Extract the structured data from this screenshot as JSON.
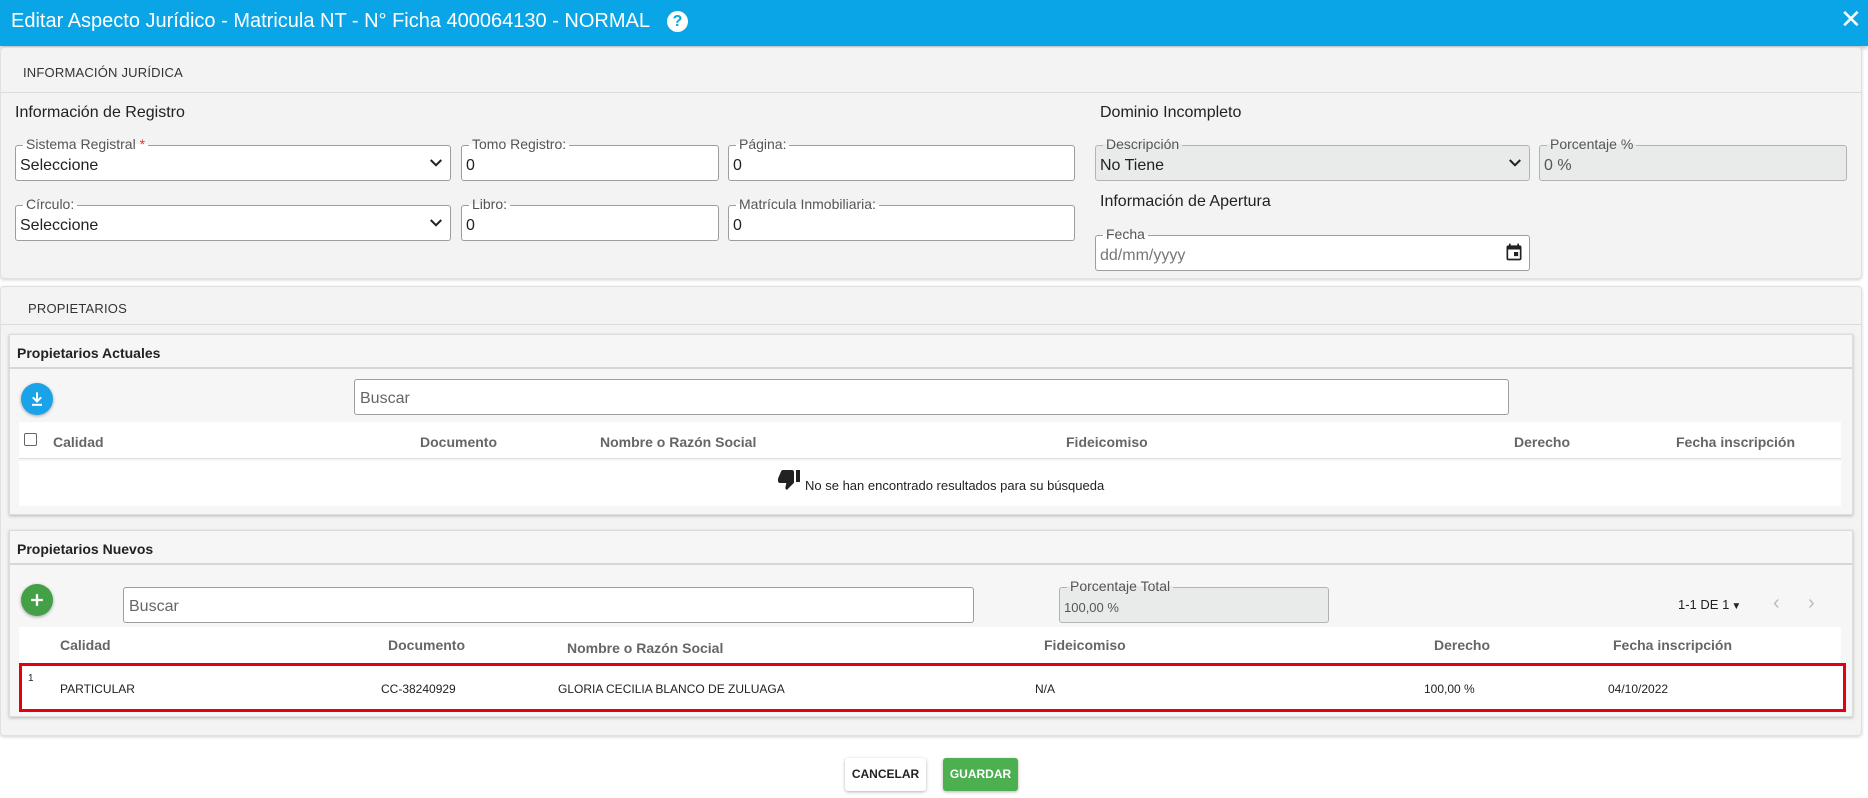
{
  "header": {
    "title": "Editar Aspecto Jurídico - Matricula NT - N° Ficha 400064130 - NORMAL",
    "help_glyph": "?",
    "close_glyph": "✕",
    "accent_color": "#0aa5e6"
  },
  "juridica": {
    "panel_title": "INFORMACIÓN JURÍDICA",
    "registro_title": "Información de Registro",
    "sistema_registral": {
      "label": "Sistema Registral",
      "required_mark": "*",
      "value": "Seleccione"
    },
    "tomo_registro": {
      "label": "Tomo Registro:",
      "value": "0"
    },
    "pagina": {
      "label": "Página:",
      "value": "0"
    },
    "circulo": {
      "label": "Círculo:",
      "value": "Seleccione"
    },
    "libro": {
      "label": "Libro:",
      "value": "0"
    },
    "matricula_inmobiliaria": {
      "label": "Matrícula Inmobiliaria:",
      "value": "0"
    },
    "dominio_title": "Dominio Incompleto",
    "descripcion": {
      "label": "Descripción",
      "value": "No Tiene"
    },
    "porcentaje": {
      "label": "Porcentaje %",
      "value": "0 %"
    },
    "apertura_title": "Información de Apertura",
    "fecha": {
      "label": "Fecha",
      "placeholder": "dd/mm/yyyy"
    }
  },
  "propietarios": {
    "panel_title": "PROPIETARIOS",
    "actuales": {
      "title": "Propietarios Actuales",
      "search_placeholder": "Buscar",
      "columns": [
        "Calidad",
        "Documento",
        "Nombre o Razón Social",
        "Fideicomiso",
        "Derecho",
        "Fecha inscripción"
      ],
      "empty_message": "No se han encontrado resultados para su búsqueda"
    },
    "nuevos": {
      "title": "Propietarios Nuevos",
      "search_placeholder": "Buscar",
      "porcentaje_total": {
        "label": "Porcentaje Total",
        "value": "100,00 %"
      },
      "pagination": "1-1 DE 1",
      "columns": [
        "Calidad",
        "Documento",
        "Nombre o Razón Social",
        "Fideicomiso",
        "Derecho",
        "Fecha inscripción"
      ],
      "rows": [
        {
          "index": "1",
          "calidad": "PARTICULAR",
          "documento": "CC-38240929",
          "nombre": "GLORIA CECILIA BLANCO DE ZULUAGA",
          "fideicomiso": "N/A",
          "derecho": "100,00 %",
          "fecha": "04/10/2022"
        }
      ],
      "highlight_color": "#e3000f"
    }
  },
  "footer": {
    "cancel_label": "CANCELAR",
    "save_label": "GUARDAR",
    "save_color": "#4caf50"
  }
}
